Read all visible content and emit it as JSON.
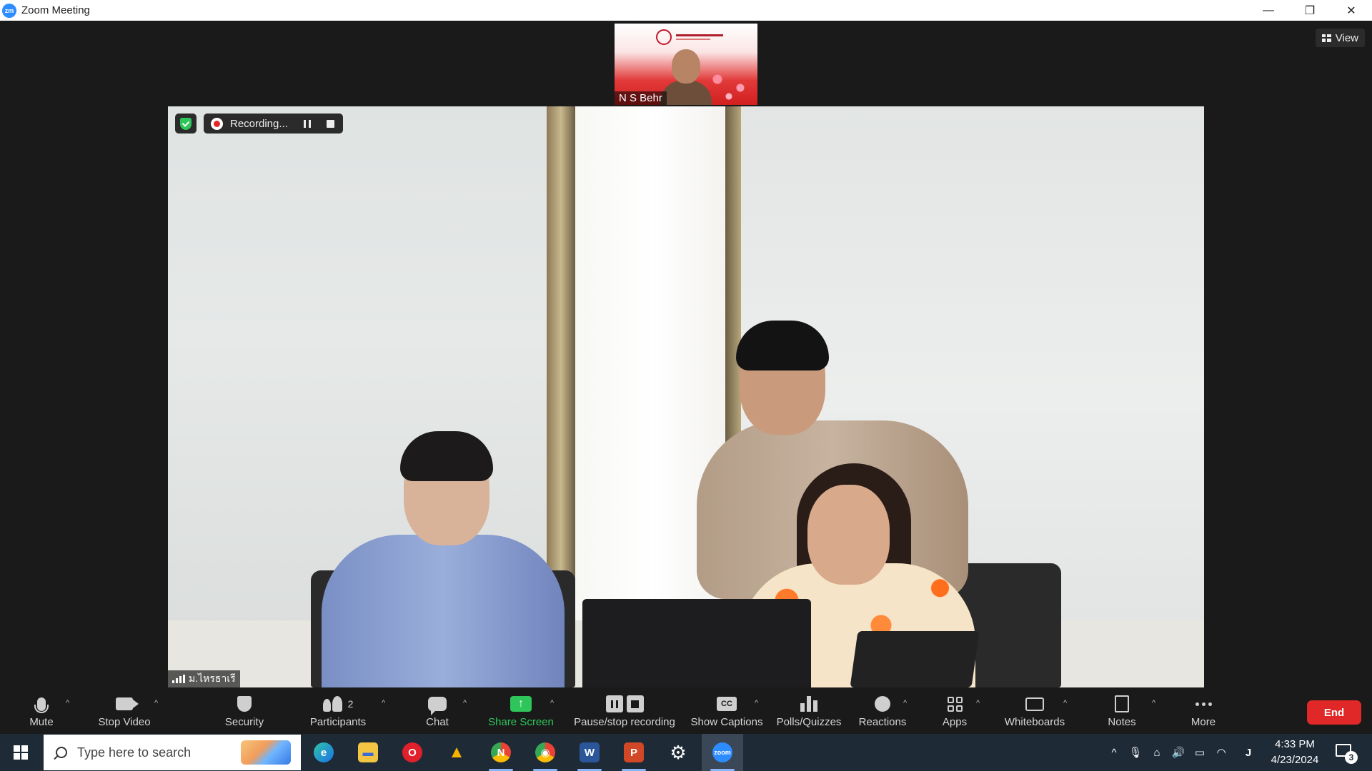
{
  "window": {
    "app_logo": "zm",
    "title": "Zoom Meeting",
    "controls": {
      "minimize": "—",
      "restore": "❐",
      "close": "✕"
    }
  },
  "meeting": {
    "view_label": "View",
    "thumbnail": {
      "name": "N S Behr"
    },
    "recording": {
      "status": "Recording..."
    },
    "active_speaker": {
      "name": "ม.ไหรธาเรี"
    }
  },
  "toolbar": {
    "mute": "Mute",
    "stop_video": "Stop Video",
    "security": "Security",
    "participants": "Participants",
    "participants_count": "2",
    "chat": "Chat",
    "share_screen": "Share Screen",
    "share_arrow": "↑",
    "pause_stop_recording": "Pause/stop recording",
    "show_captions": "Show Captions",
    "cc": "CC",
    "polls": "Polls/Quizzes",
    "reactions": "Reactions",
    "apps": "Apps",
    "whiteboards": "Whiteboards",
    "notes": "Notes",
    "more": "More",
    "end": "End",
    "caret": "^",
    "accent_green": "#2ec65a",
    "end_red": "#e02828"
  },
  "taskbar": {
    "search_placeholder": "Type here to search",
    "apps": [
      {
        "name": "edge",
        "glyph": "e"
      },
      {
        "name": "file-explorer",
        "glyph": "▬"
      },
      {
        "name": "opera",
        "glyph": "O"
      },
      {
        "name": "google-drive",
        "glyph": "▲"
      },
      {
        "name": "chrome-n",
        "glyph": "N"
      },
      {
        "name": "chrome",
        "glyph": "◉"
      },
      {
        "name": "word",
        "glyph": "W"
      },
      {
        "name": "powerpoint",
        "glyph": "P"
      },
      {
        "name": "settings",
        "glyph": "⚙"
      },
      {
        "name": "zoom",
        "glyph": "zoom"
      }
    ],
    "tray": {
      "chevron": "^",
      "mic": "🎙",
      "network": "⌂",
      "volume": "🔊",
      "battery": "▭",
      "wifi": "◠",
      "ime": "J"
    },
    "time": "4:33 PM",
    "date": "4/23/2024",
    "notifications": "3"
  }
}
